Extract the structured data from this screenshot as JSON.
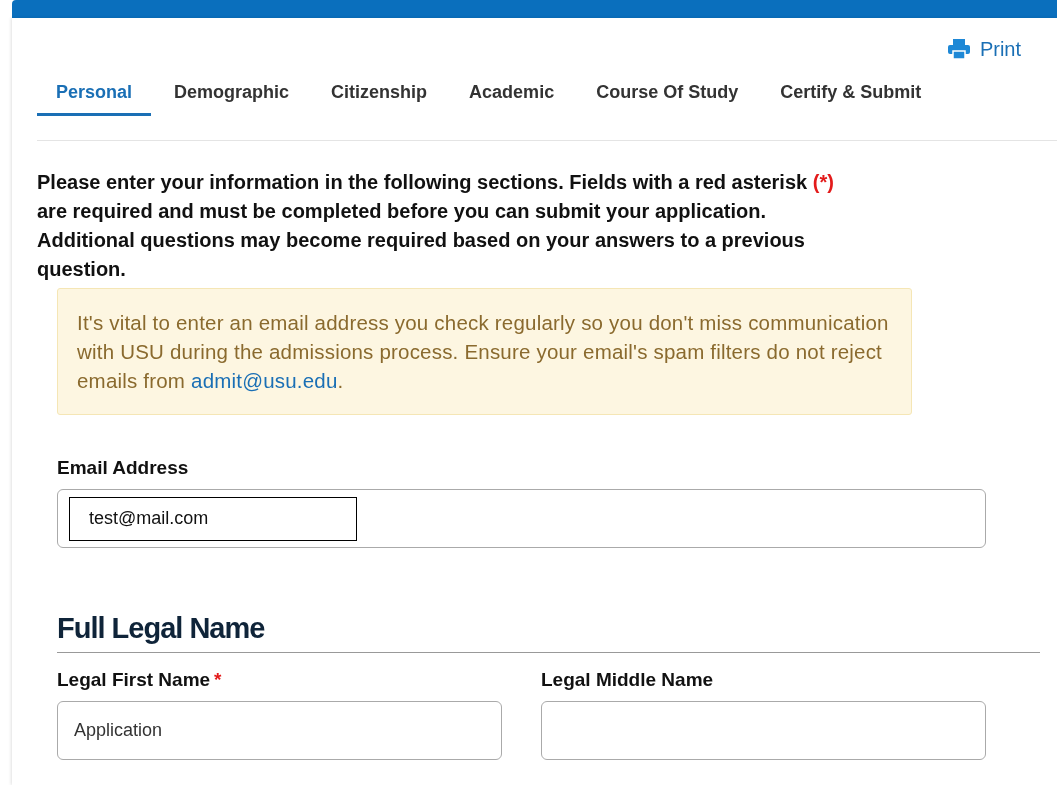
{
  "print": {
    "label": "Print"
  },
  "tabs": [
    {
      "label": "Personal",
      "selected": true
    },
    {
      "label": "Demographic",
      "selected": false
    },
    {
      "label": "Citizenship",
      "selected": false
    },
    {
      "label": "Academic",
      "selected": false
    },
    {
      "label": "Course Of Study",
      "selected": false
    },
    {
      "label": "Certify & Submit",
      "selected": false
    }
  ],
  "intro": {
    "before": "Please enter your information in the following sections. Fields with a red asterisk",
    "marker": "(*)",
    "after": "are required and must be completed before you can submit your application. Additional questions may become required based on your answers to a previous question."
  },
  "notice": {
    "text": "It's vital to enter an email address you check regularly so you don't miss communication with USU during the admissions process. Ensure your email's spam filters do not reject emails from",
    "link": "admit@usu.edu",
    "end": "."
  },
  "email": {
    "label": "Email Address",
    "value": "test@mail.com"
  },
  "section": {
    "title": "Full Legal Name",
    "required_marker": "*",
    "fields": [
      {
        "label": "Legal First Name",
        "value": "Application",
        "required": true
      },
      {
        "label": "Legal Middle Name",
        "required": false
      }
    ]
  }
}
